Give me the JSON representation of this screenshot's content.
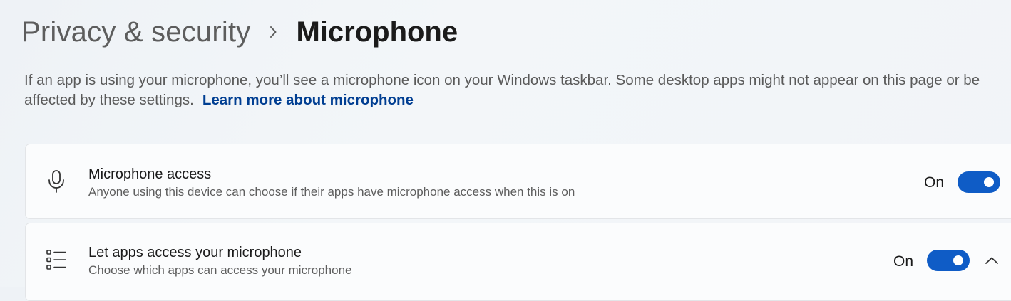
{
  "header": {
    "breadcrumb_parent": "Privacy & security",
    "breadcrumb_current": "Microphone"
  },
  "description": {
    "line1": "If an app is using your microphone, you’ll see a microphone icon on your Windows taskbar. Some desktop apps might not appear on this page or be",
    "line2": "affected by these settings.",
    "link": "Learn more about microphone"
  },
  "settings": [
    {
      "icon": "microphone-icon",
      "title": "Microphone access",
      "subtitle": "Anyone using this device can choose if their apps have microphone access when this is on",
      "state": "On",
      "toggle_on": true
    },
    {
      "icon": "app-list-icon",
      "title": "Let apps access your microphone",
      "subtitle": "Choose which apps can access your microphone",
      "state": "On",
      "toggle_on": true,
      "expanded": true
    }
  ],
  "colors": {
    "accent": "#0f5cc6",
    "link": "#003e92"
  }
}
